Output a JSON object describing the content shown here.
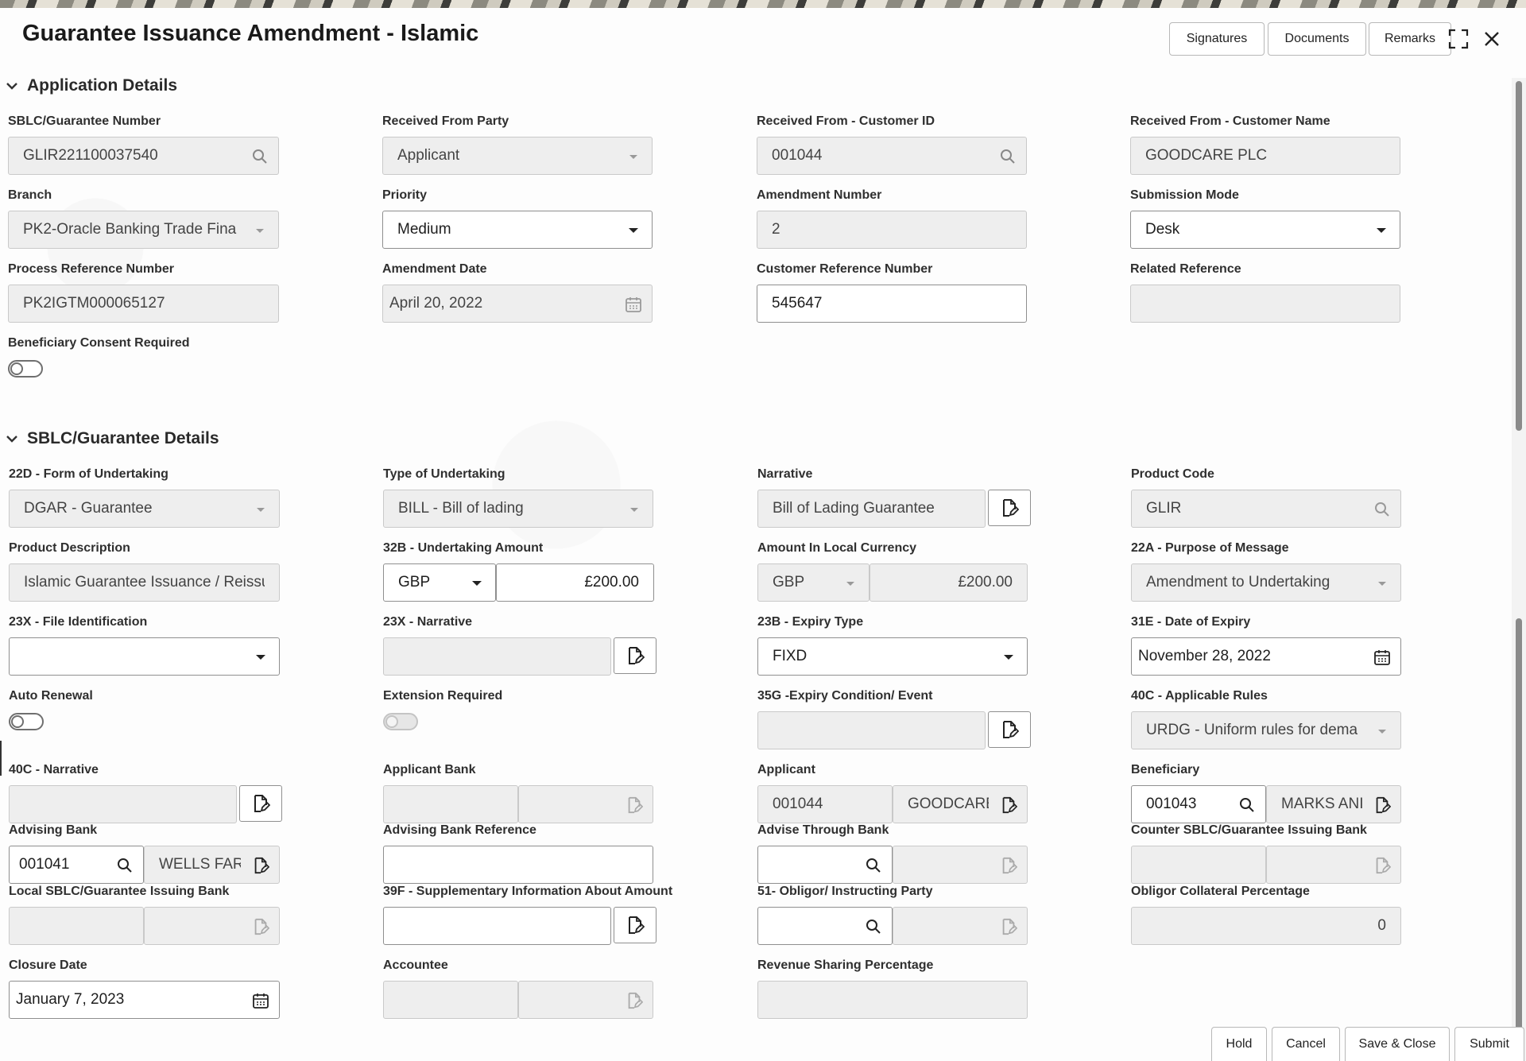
{
  "header": {
    "title": "Guarantee Issuance Amendment - Islamic",
    "buttons": {
      "signatures": "Signatures",
      "documents": "Documents",
      "remarks": "Remarks"
    },
    "icons": {
      "expand": "expand-icon",
      "close": "close-icon"
    }
  },
  "application_details": {
    "title": "Application Details",
    "sblc_number": {
      "label": "SBLC/Guarantee Number",
      "value": "GLIR221100037540"
    },
    "received_from_party": {
      "label": "Received From Party",
      "value": "Applicant"
    },
    "received_customer_id": {
      "label": "Received From - Customer ID",
      "value": "001044"
    },
    "received_customer_name": {
      "label": "Received From - Customer Name",
      "value": "GOODCARE PLC"
    },
    "branch": {
      "label": "Branch",
      "value": "PK2-Oracle Banking Trade Fina"
    },
    "priority": {
      "label": "Priority",
      "value": "Medium"
    },
    "amendment_number": {
      "label": "Amendment Number",
      "value": "2"
    },
    "submission_mode": {
      "label": "Submission Mode",
      "value": "Desk"
    },
    "process_reference": {
      "label": "Process Reference Number",
      "value": "PK2IGTM000065127"
    },
    "amendment_date": {
      "label": "Amendment Date",
      "value": "April 20, 2022"
    },
    "customer_reference": {
      "label": "Customer Reference Number",
      "value": "545647"
    },
    "related_reference": {
      "label": "Related Reference",
      "value": ""
    },
    "beneficiary_consent": {
      "label": "Beneficiary Consent Required"
    }
  },
  "guarantee_details": {
    "title": "SBLC/Guarantee Details",
    "form_of_undertaking": {
      "label": "22D - Form of Undertaking",
      "value": "DGAR - Guarantee"
    },
    "type_of_undertaking": {
      "label": "Type of Undertaking",
      "value": "BILL - Bill of lading"
    },
    "narrative": {
      "label": "Narrative",
      "value": "Bill of Lading Guarantee"
    },
    "product_code": {
      "label": "Product Code",
      "value": "GLIR"
    },
    "product_description": {
      "label": "Product Description",
      "value": "Islamic  Guarantee Issuance / Reissu"
    },
    "undertaking_amount": {
      "label": "32B - Undertaking Amount",
      "currency": "GBP",
      "value": "£200.00"
    },
    "amount_local": {
      "label": "Amount In Local Currency",
      "currency": "GBP",
      "value": "£200.00"
    },
    "purpose_of_message": {
      "label": "22A - Purpose of Message",
      "value": "Amendment to Undertaking"
    },
    "file_identification": {
      "label": "23X - File Identification",
      "value": ""
    },
    "narrative_23x": {
      "label": "23X - Narrative",
      "value": ""
    },
    "expiry_type": {
      "label": "23B - Expiry Type",
      "value": "FIXD"
    },
    "date_of_expiry": {
      "label": "31E - Date of Expiry",
      "value": "November 28, 2022"
    },
    "auto_renewal": {
      "label": "Auto Renewal"
    },
    "extension_required": {
      "label": "Extension Required"
    },
    "expiry_condition": {
      "label": "35G -Expiry Condition/ Event",
      "value": ""
    },
    "applicable_rules": {
      "label": "40C - Applicable Rules",
      "value": "URDG - Uniform rules for dema"
    },
    "narrative_40c": {
      "label": "40C - Narrative",
      "value": ""
    },
    "applicant_bank": {
      "label": "Applicant Bank",
      "value": ""
    },
    "applicant": {
      "label": "Applicant",
      "id": "001044",
      "name": "GOODCARE"
    },
    "beneficiary": {
      "label": "Beneficiary",
      "id": "001043",
      "name": "MARKS ANI"
    },
    "advising_bank": {
      "label": "Advising Bank",
      "id": "001041",
      "name": "WELLS FAR"
    },
    "advising_bank_ref": {
      "label": "Advising Bank Reference",
      "value": ""
    },
    "advise_through_bank": {
      "label": "Advise Through Bank",
      "value": ""
    },
    "counter_issuing_bank": {
      "label": "Counter SBLC/Guarantee Issuing Bank",
      "value": ""
    },
    "local_issuing_bank": {
      "label": "Local SBLC/Guarantee Issuing Bank",
      "value": ""
    },
    "supplementary_info": {
      "label": "39F - Supplementary Information About Amount",
      "value": ""
    },
    "obligor": {
      "label": "51- Obligor/ Instructing Party",
      "value": ""
    },
    "obligor_collateral": {
      "label": "Obligor Collateral Percentage",
      "value": "0"
    },
    "closure_date": {
      "label": "Closure Date",
      "value": "January 7, 2023"
    },
    "accountee": {
      "label": "Accountee",
      "value": ""
    },
    "revenue_sharing": {
      "label": "Revenue Sharing Percentage",
      "value": ""
    }
  },
  "footer": {
    "hold": "Hold",
    "cancel": "Cancel",
    "save_close": "Save & Close",
    "submit": "Submit"
  }
}
